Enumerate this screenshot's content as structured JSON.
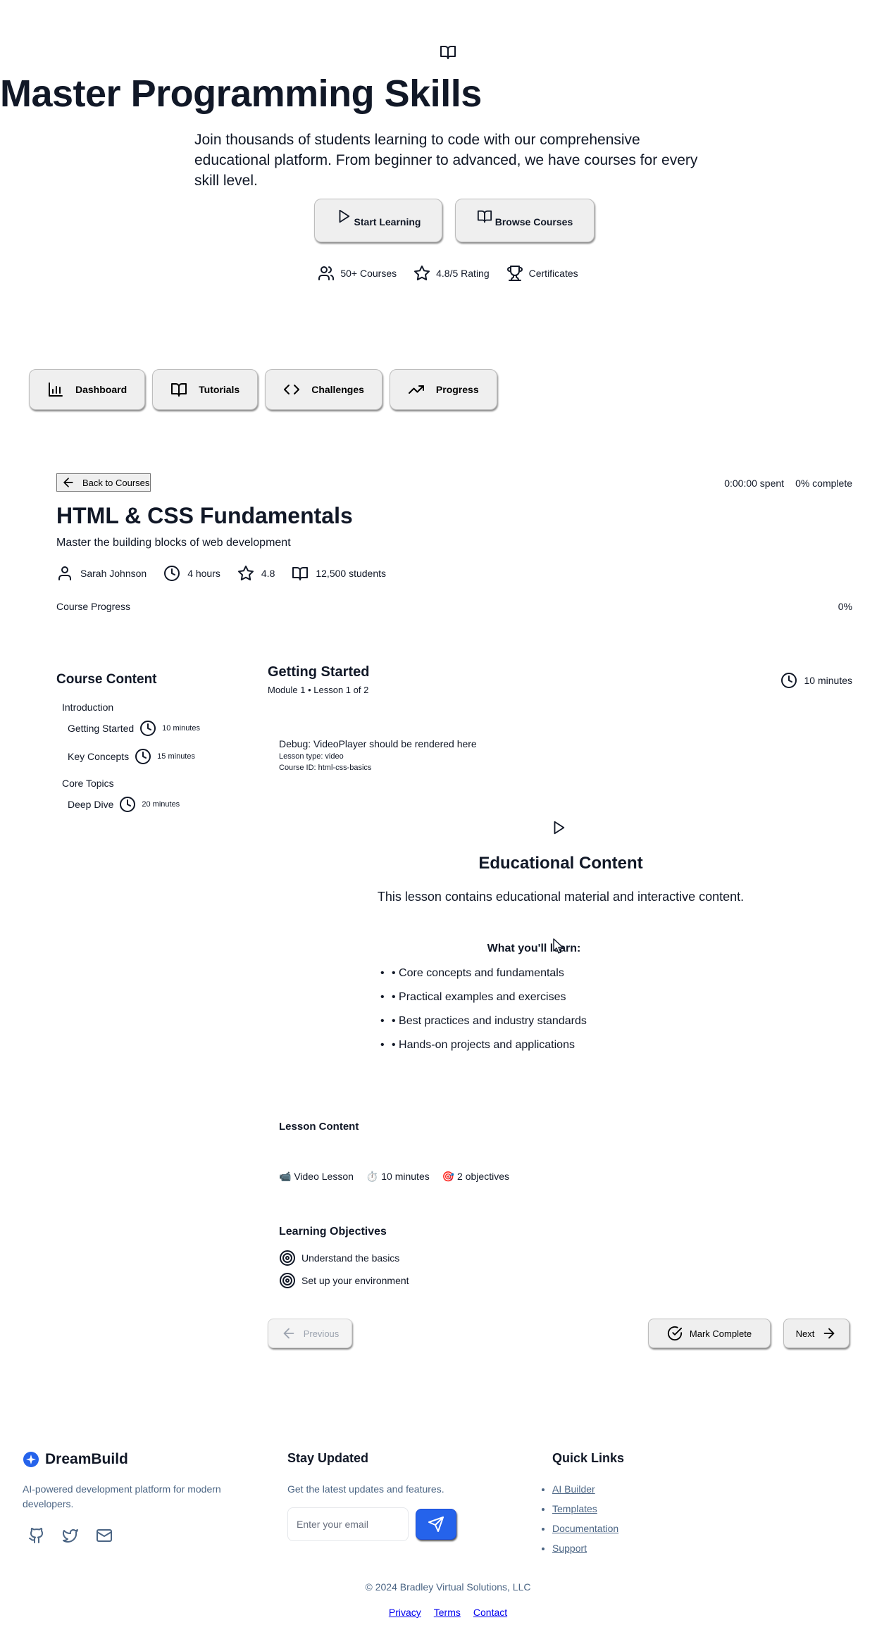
{
  "hero": {
    "icon": "book-open-icon",
    "title": "Master Programming Skills",
    "subtitle": "Join thousands of students learning to code with our comprehensive educational platform. From beginner to advanced, we have courses for every skill level.",
    "start_label": "Start Learning",
    "browse_label": "Browse Courses",
    "stats": [
      {
        "icon": "users-icon",
        "label": "50+ Courses"
      },
      {
        "icon": "star-icon",
        "label": "4.8/5 Rating"
      },
      {
        "icon": "trophy-icon",
        "label": "Certificates"
      }
    ]
  },
  "nav": [
    {
      "icon": "bar-chart-icon",
      "label": "Dashboard"
    },
    {
      "icon": "book-open-icon",
      "label": "Tutorials"
    },
    {
      "icon": "code-icon",
      "label": "Challenges"
    },
    {
      "icon": "trending-up-icon",
      "label": "Progress"
    }
  ],
  "course": {
    "back_label": "Back to Courses",
    "time_spent": "0:00:00 spent",
    "complete": "0% complete",
    "title": "HTML & CSS Fundamentals",
    "subtitle": "Master the building blocks of web development",
    "instructor": "Sarah Johnson",
    "duration": "4 hours",
    "rating": "4.8",
    "students": "12,500 students",
    "progress_label": "Course Progress",
    "progress_value": "0%",
    "progress_fraction": 0
  },
  "sidebar": {
    "title": "Course Content",
    "modules": [
      {
        "title": "Introduction",
        "lessons": [
          {
            "title": "Getting Started",
            "duration": "10 minutes"
          },
          {
            "title": "Key Concepts",
            "duration": "15 minutes"
          }
        ]
      },
      {
        "title": "Core Topics",
        "lessons": [
          {
            "title": "Deep Dive",
            "duration": "20 minutes"
          }
        ]
      }
    ]
  },
  "lesson": {
    "title": "Getting Started",
    "subtitle": "Module 1 • Lesson 1 of 2",
    "duration": "10 minutes",
    "debug_line": "Debug: VideoPlayer should be rendered here",
    "debug_type": "Lesson type: video",
    "debug_course": "Course ID: html-css-basics",
    "content_title": "Educational Content",
    "content_text": "This lesson contains educational material and interactive content.",
    "learn_title": "What you'll learn:",
    "learn_items": [
      "• Core concepts and fundamentals",
      "• Practical examples and exercises",
      "• Best practices and industry standards",
      "• Hands-on projects and applications"
    ],
    "lesson_content_title": "Lesson Content",
    "lesson_meta": [
      "📹 Video Lesson",
      "⏱️ 10 minutes",
      "🎯 2 objectives"
    ],
    "objectives_title": "Learning Objectives",
    "objectives": [
      "Understand the basics",
      "Set up your environment"
    ],
    "prev_label": "Previous",
    "complete_label": "Mark Complete",
    "next_label": "Next"
  },
  "footer": {
    "brand": "DreamBuild",
    "brand_desc": "AI-powered development platform for modern developers.",
    "socials": [
      "github-icon",
      "twitter-icon",
      "mail-icon"
    ],
    "stay_title": "Stay Updated",
    "stay_desc": "Get the latest updates and features.",
    "email_placeholder": "Enter your email",
    "quick_title": "Quick Links",
    "quick_links": [
      "AI Builder",
      "Templates",
      "Documentation",
      "Support"
    ],
    "copyright": "© 2024 Bradley Virtual Solutions, LLC",
    "legal": [
      "Privacy",
      "Terms",
      "Contact"
    ]
  },
  "colors": {
    "text": "#111827",
    "muted": "#4b6584",
    "accent": "#2563eb",
    "button_bg": "#efefef"
  }
}
